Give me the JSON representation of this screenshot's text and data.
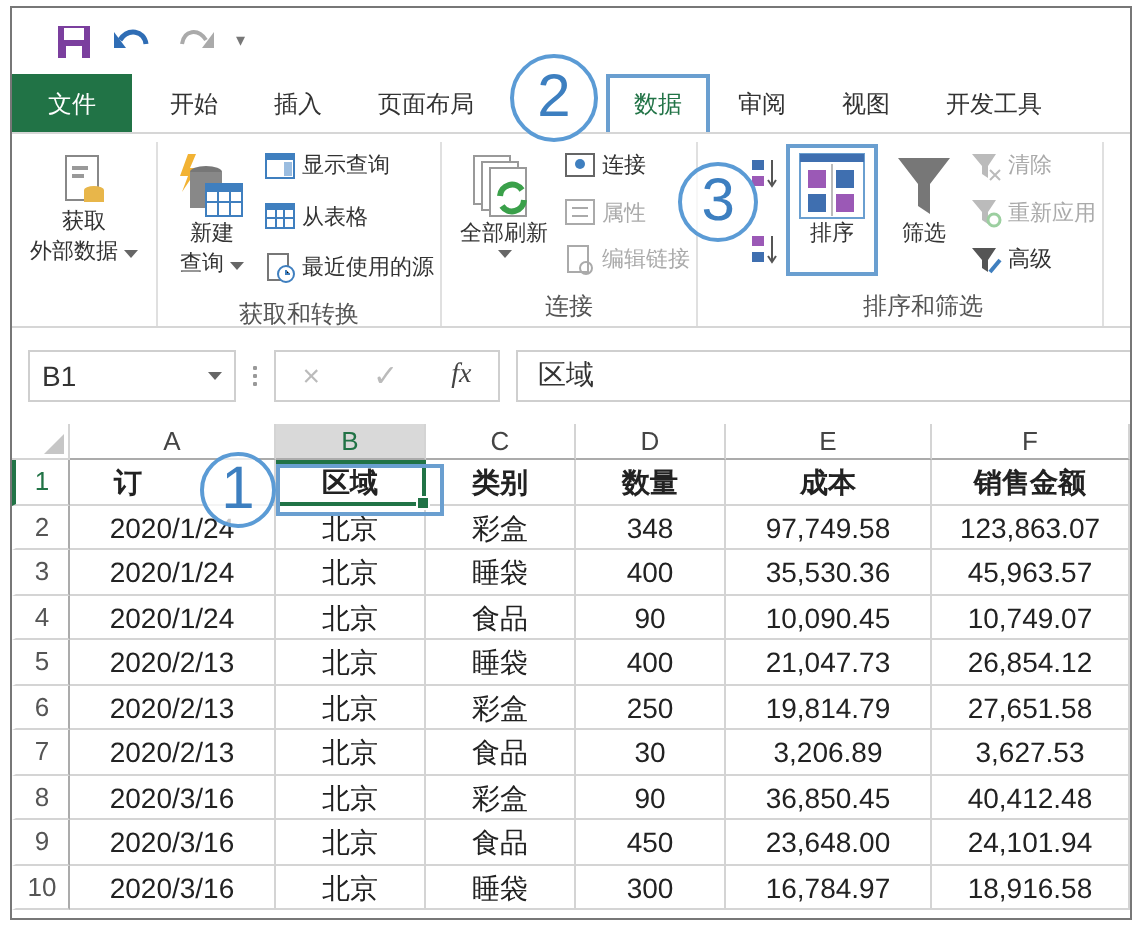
{
  "quick_access": {
    "customize": "▾"
  },
  "tabs": [
    {
      "label": "文件",
      "kind": "file",
      "selected": false
    },
    {
      "label": "开始",
      "kind": "tab",
      "selected": false
    },
    {
      "label": "插入",
      "kind": "tab",
      "selected": false
    },
    {
      "label": "页面布局",
      "kind": "tab",
      "selected": false
    },
    {
      "label": "数据",
      "kind": "tab",
      "selected": true
    },
    {
      "label": "审阅",
      "kind": "tab",
      "selected": false
    },
    {
      "label": "视图",
      "kind": "tab",
      "selected": false
    },
    {
      "label": "开发工具",
      "kind": "tab",
      "selected": false
    }
  ],
  "ribbon": {
    "groups": [
      {
        "columns": [
          [
            {
              "kind": "large",
              "lines": [
                "获取",
                "外部数据"
              ],
              "dropdown": true,
              "disabled": false,
              "highlighted": false
            }
          ]
        ]
      },
      {
        "label": "获取和转换",
        "columns": [
          [
            {
              "kind": "large",
              "lines": [
                "新建",
                "查询"
              ],
              "dropdown": true,
              "disabled": false,
              "highlighted": false
            }
          ],
          [
            {
              "kind": "small",
              "label": "显示查询",
              "disabled": false
            },
            {
              "kind": "small",
              "label": "从表格",
              "disabled": false
            },
            {
              "kind": "small",
              "label": "最近使用的源",
              "disabled": false
            }
          ]
        ]
      },
      {
        "label": "连接",
        "columns": [
          [
            {
              "kind": "large",
              "lines": [
                "全部刷新"
              ],
              "dropdown": true,
              "disabled": false,
              "highlighted": false
            }
          ],
          [
            {
              "kind": "small",
              "label": "连接",
              "disabled": false
            },
            {
              "kind": "small",
              "label": "属性",
              "disabled": true
            },
            {
              "kind": "small",
              "label": "编辑链接",
              "disabled": true
            }
          ]
        ]
      },
      {
        "label": "排序和筛选",
        "columns": [
          [
            {
              "kind": "icon",
              "disabled": false
            },
            {
              "kind": "icon",
              "disabled": false
            }
          ],
          [
            {
              "kind": "large",
              "lines": [
                "排序"
              ],
              "dropdown": false,
              "disabled": false,
              "highlighted": true
            }
          ],
          [
            {
              "kind": "large",
              "lines": [
                "筛选"
              ],
              "dropdown": false,
              "disabled": false,
              "highlighted": false
            }
          ],
          [
            {
              "kind": "small",
              "label": "清除",
              "disabled": true
            },
            {
              "kind": "small",
              "label": "重新应用",
              "disabled": true
            },
            {
              "kind": "small",
              "label": "高级",
              "disabled": false
            }
          ]
        ]
      }
    ]
  },
  "formula_bar": {
    "name_box": "B1",
    "buttons": [
      "×",
      "✓",
      "fx"
    ],
    "formula": "区域"
  },
  "sheet": {
    "columns": [
      {
        "label": "A",
        "selected": false
      },
      {
        "label": "B",
        "selected": true
      },
      {
        "label": "C",
        "selected": false
      },
      {
        "label": "D",
        "selected": false
      },
      {
        "label": "E",
        "selected": false
      },
      {
        "label": "F",
        "selected": false
      }
    ],
    "rows": [
      {
        "number": "1",
        "header": true,
        "selected": true,
        "cells": [
          "订",
          "区域",
          "类别",
          "数量",
          "成本",
          "销售金额"
        ]
      },
      {
        "number": "2",
        "header": false,
        "selected": false,
        "cells": [
          "2020/1/24",
          "北京",
          "彩盒",
          "348",
          "97,749.58",
          "123,863.07"
        ]
      },
      {
        "number": "3",
        "header": false,
        "selected": false,
        "cells": [
          "2020/1/24",
          "北京",
          "睡袋",
          "400",
          "35,530.36",
          "45,963.57"
        ]
      },
      {
        "number": "4",
        "header": false,
        "selected": false,
        "cells": [
          "2020/1/24",
          "北京",
          "食品",
          "90",
          "10,090.45",
          "10,749.07"
        ]
      },
      {
        "number": "5",
        "header": false,
        "selected": false,
        "cells": [
          "2020/2/13",
          "北京",
          "睡袋",
          "400",
          "21,047.73",
          "26,854.12"
        ]
      },
      {
        "number": "6",
        "header": false,
        "selected": false,
        "cells": [
          "2020/2/13",
          "北京",
          "彩盒",
          "250",
          "19,814.79",
          "27,651.58"
        ]
      },
      {
        "number": "7",
        "header": false,
        "selected": false,
        "cells": [
          "2020/2/13",
          "北京",
          "食品",
          "30",
          "3,206.89",
          "3,627.53"
        ]
      },
      {
        "number": "8",
        "header": false,
        "selected": false,
        "cells": [
          "2020/3/16",
          "北京",
          "彩盒",
          "90",
          "36,850.45",
          "40,412.48"
        ]
      },
      {
        "number": "9",
        "header": false,
        "selected": false,
        "cells": [
          "2020/3/16",
          "北京",
          "食品",
          "450",
          "23,648.00",
          "24,101.94"
        ]
      },
      {
        "number": "10",
        "header": false,
        "selected": false,
        "cells": [
          "2020/3/16",
          "北京",
          "睡袋",
          "300",
          "16,784.97",
          "18,916.58"
        ]
      }
    ]
  },
  "callouts": [
    {
      "number": "1"
    },
    {
      "number": "2"
    },
    {
      "number": "3"
    }
  ]
}
